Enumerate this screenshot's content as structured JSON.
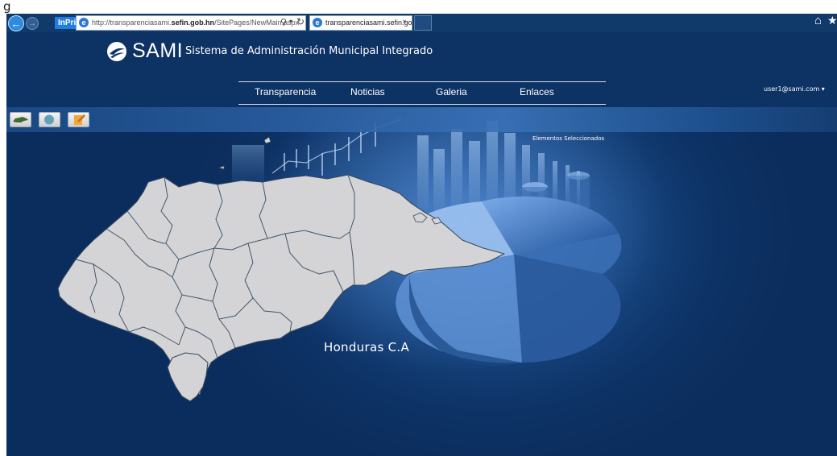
{
  "window": {
    "title": "g"
  },
  "browser": {
    "inprivate_label": "InPrivate",
    "url_prefix": "http://transparenciasami.",
    "url_host": "sefin.gob.hn",
    "url_path": "/SitePages/NewMain.aspx",
    "tab_title": "transparenciasami.sefin.go...",
    "tab_close": "×",
    "back_glyph": "←",
    "forward_glyph": "→",
    "search_glyph": "⚲",
    "dropdown_glyph": "▾",
    "refresh_glyph": "↻",
    "home_glyph": "⌂",
    "favorites_glyph": "★",
    "icons": [
      "back-arrow-icon",
      "forward-arrow-icon",
      "ie-icon",
      "search-icon",
      "refresh-icon",
      "home-icon",
      "favorites-star-icon",
      "close-icon"
    ]
  },
  "header": {
    "logo_text": "SAMI",
    "subtitle": "Sistema de Administración Municipal Integrado",
    "nav": [
      {
        "label": "Transparencia"
      },
      {
        "label": "Noticias"
      },
      {
        "label": "Galeria"
      },
      {
        "label": "Enlaces"
      }
    ],
    "user": "user1@sami.com ▾"
  },
  "toolbar": {
    "buttons": [
      "map-icon",
      "globe-icon",
      "edit-icon"
    ]
  },
  "main": {
    "selected_elements_label": "Elementos Seleccionados",
    "country_label": "Honduras C.A"
  },
  "colors": {
    "page_background": "#0b2d5d",
    "header_background": "#0d3264",
    "browser_chrome": "#0f3a69",
    "map_fill": "#d4d4d6",
    "map_stroke": "#34495e",
    "accent_blue": "#2f8be0",
    "inprivate_badge": "#1f7fe0"
  }
}
